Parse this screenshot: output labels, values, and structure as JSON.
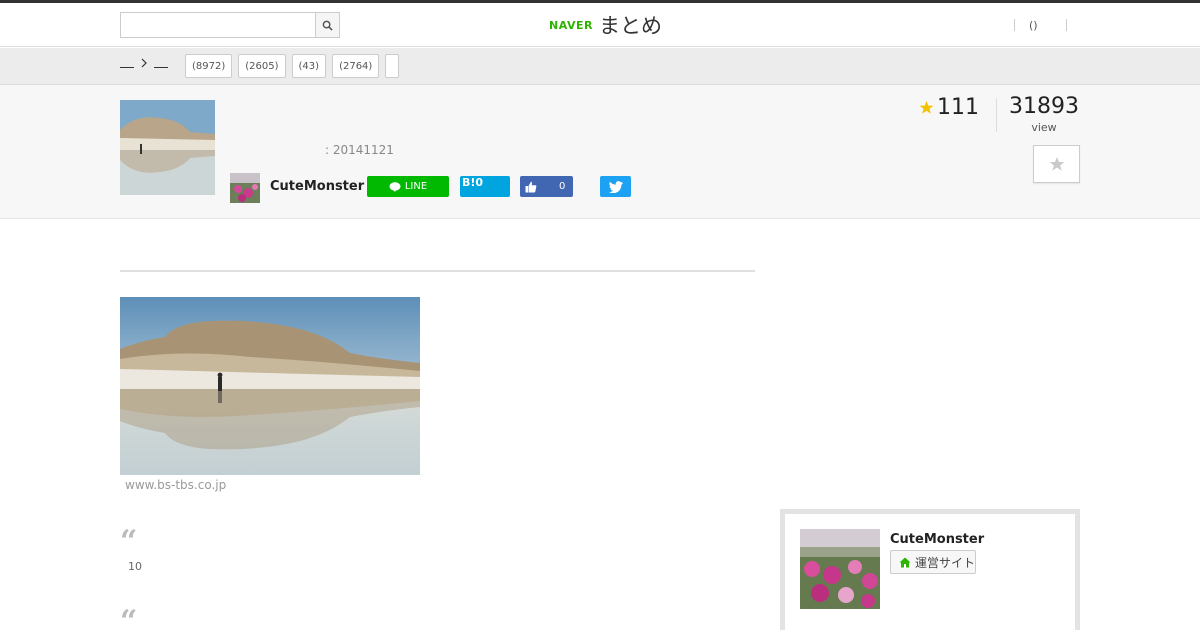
{
  "search": {
    "placeholder": "",
    "value": ""
  },
  "header": {
    "brand_naver": "NAVER",
    "brand_matome": "まとめ",
    "right_label": "()"
  },
  "subnav": {
    "tags": [
      "(8972)",
      "(2605)",
      "(43)",
      "(2764)",
      ""
    ]
  },
  "summary": {
    "date": ": 20141121",
    "author": "CuteMonster",
    "line_label": "LINE",
    "hatena_label": "B!0",
    "fb_count": "0",
    "favorites": "111",
    "views": "31893",
    "views_label": "view"
  },
  "content": {
    "image_source": "www.bs-tbs.co.jp",
    "quote_count": "10"
  },
  "sidebar": {
    "author": "CuteMonster",
    "site_button": "運営サイト"
  },
  "colors": {
    "naver_green": "#2db400",
    "line_green": "#00b900",
    "hatena_blue": "#00a4de",
    "facebook_blue": "#4267b2",
    "twitter_blue": "#1da1f2",
    "star_yellow": "#f2c200"
  },
  "icons": {
    "search": "magnifier-icon",
    "favorite": "star-icon",
    "line": "line-bubble-icon",
    "facebook": "thumbs-up-icon",
    "twitter": "bird-icon",
    "home": "house-icon"
  }
}
